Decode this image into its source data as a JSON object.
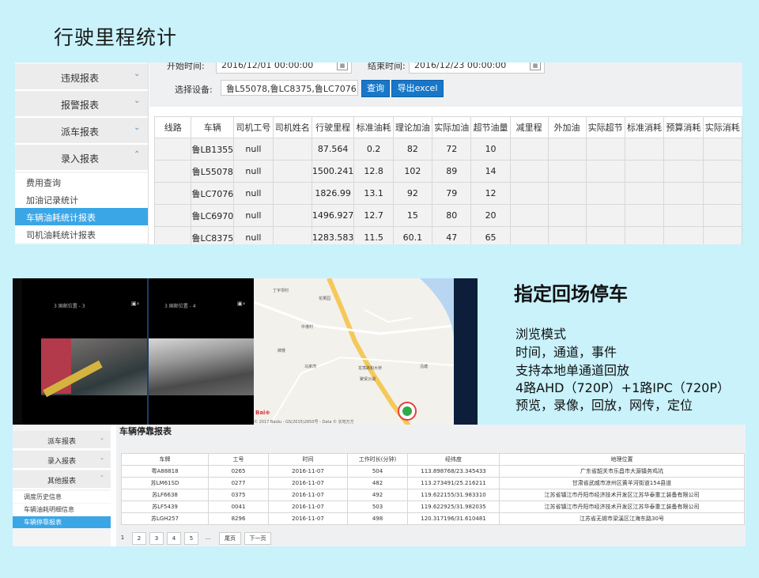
{
  "heading1": "行驶里程统计",
  "heading2": "指定回场停车",
  "features": [
    "浏览模式",
    "时间，通道，事件",
    "支持本地单通道回放",
    "4路AHD（720P）+1路IPC（720P）",
    "预览，录像，回放，网传，定位"
  ],
  "report1": {
    "sidebar": {
      "groups": [
        {
          "label": "违规报表",
          "chev": "⌄"
        },
        {
          "label": "报警报表",
          "chev": "⌄"
        },
        {
          "label": "派车报表",
          "chev": "⌄"
        },
        {
          "label": "录入报表",
          "chev": "⌃"
        }
      ],
      "items": [
        "费用查询",
        "加油记录统计",
        "车辆油耗统计报表",
        "司机油耗统计报表"
      ]
    },
    "form": {
      "start_label": "开始时间:",
      "start_value": "2016/12/01 00:00:00",
      "end_label": "结束时间:",
      "end_value": "2016/12/23 00:00:00",
      "device_label": "选择设备:",
      "device_value": "鲁L55078,鲁LC8375,鲁LC7076,鲁LC",
      "query_btn": "查询",
      "export_btn": "导出excel"
    },
    "columns": [
      "线路",
      "车辆",
      "司机工号",
      "司机姓名",
      "行驶里程",
      "标准油耗",
      "理论加油",
      "实际加油",
      "超节油量",
      "减里程",
      "外加油",
      "实际超节",
      "标准消耗",
      "预算消耗",
      "实际消耗"
    ],
    "rows": [
      [
        "",
        "鲁LB1355",
        "null",
        "",
        "87.564",
        "0.2",
        "82",
        "72",
        "10",
        "",
        "",
        "",
        "",
        "",
        ""
      ],
      [
        "",
        "鲁L55078",
        "null",
        "",
        "1500.241",
        "12.8",
        "102",
        "89",
        "14",
        "",
        "",
        "",
        "",
        "",
        ""
      ],
      [
        "",
        "鲁LC7076",
        "null",
        "",
        "1826.99",
        "13.1",
        "92",
        "79",
        "12",
        "",
        "",
        "",
        "",
        "",
        ""
      ],
      [
        "",
        "鲁LC6970",
        "null",
        "",
        "1496.927",
        "12.7",
        "15",
        "80",
        "20",
        "",
        "",
        "",
        "",
        "",
        ""
      ],
      [
        "",
        "鲁LC8375",
        "null",
        "",
        "1283.583",
        "11.5",
        "60.1",
        "47",
        "65",
        "",
        "",
        "",
        "",
        "",
        ""
      ]
    ]
  },
  "video": {
    "ch1_label": "3 国邮位置 - 3",
    "ch2_label": "3 国邮位置 - 4",
    "map_places": [
      "丁字坝村",
      "花果园",
      "中港村",
      "牌楼",
      "马家湾",
      "沿塘",
      "龙荡路和大桥",
      "聚贤沙湖"
    ],
    "map_copyright": "© 2017 Baidu - GS(2015)2650号 - Data © 长地万方"
  },
  "report2": {
    "sidebar": {
      "groups": [
        {
          "label": "派车报表",
          "chev": "⌄"
        },
        {
          "label": "录入报表",
          "chev": "⌄"
        },
        {
          "label": "其他报表",
          "chev": "⌃"
        }
      ],
      "items": [
        "调度历史信息",
        "车辆油耗明细信息",
        "车辆停靠报表"
      ]
    },
    "title": "车辆停靠报表",
    "columns": [
      "车牌",
      "工号",
      "时间",
      "工作时长(分钟)",
      "经纬度",
      "地理位置"
    ],
    "rows": [
      [
        "粤A88818",
        "0265",
        "2016-11-07",
        "504",
        "113.898768/23.345433",
        "广东省韶关市乐昌市大源镇务鸡坑"
      ],
      [
        "苏LM61SD",
        "0277",
        "2016-11-07",
        "482",
        "113.273491/25.216211",
        "甘肃省武威市凉州区黄羊河街道154县道"
      ],
      [
        "苏LF6638",
        "0375",
        "2016-11-07",
        "492",
        "119.622155/31.983310",
        "江苏省镇江市丹阳市经济技术开发区江苏华泰重工装备有限公司"
      ],
      [
        "苏LF5439",
        "0041",
        "2016-11-07",
        "503",
        "119.622925/31.982035",
        "江苏省镇江市丹阳市经济技术开发区江苏华泰重工装备有限公司"
      ],
      [
        "苏LGH257",
        "8296",
        "2016-11-07",
        "498",
        "120.317196/31.610481",
        "江苏省无锡市梁溪区江海东路30号"
      ]
    ],
    "pagination": [
      "1",
      "2",
      "3",
      "4",
      "5",
      "...",
      "尾页",
      "下一页"
    ]
  }
}
